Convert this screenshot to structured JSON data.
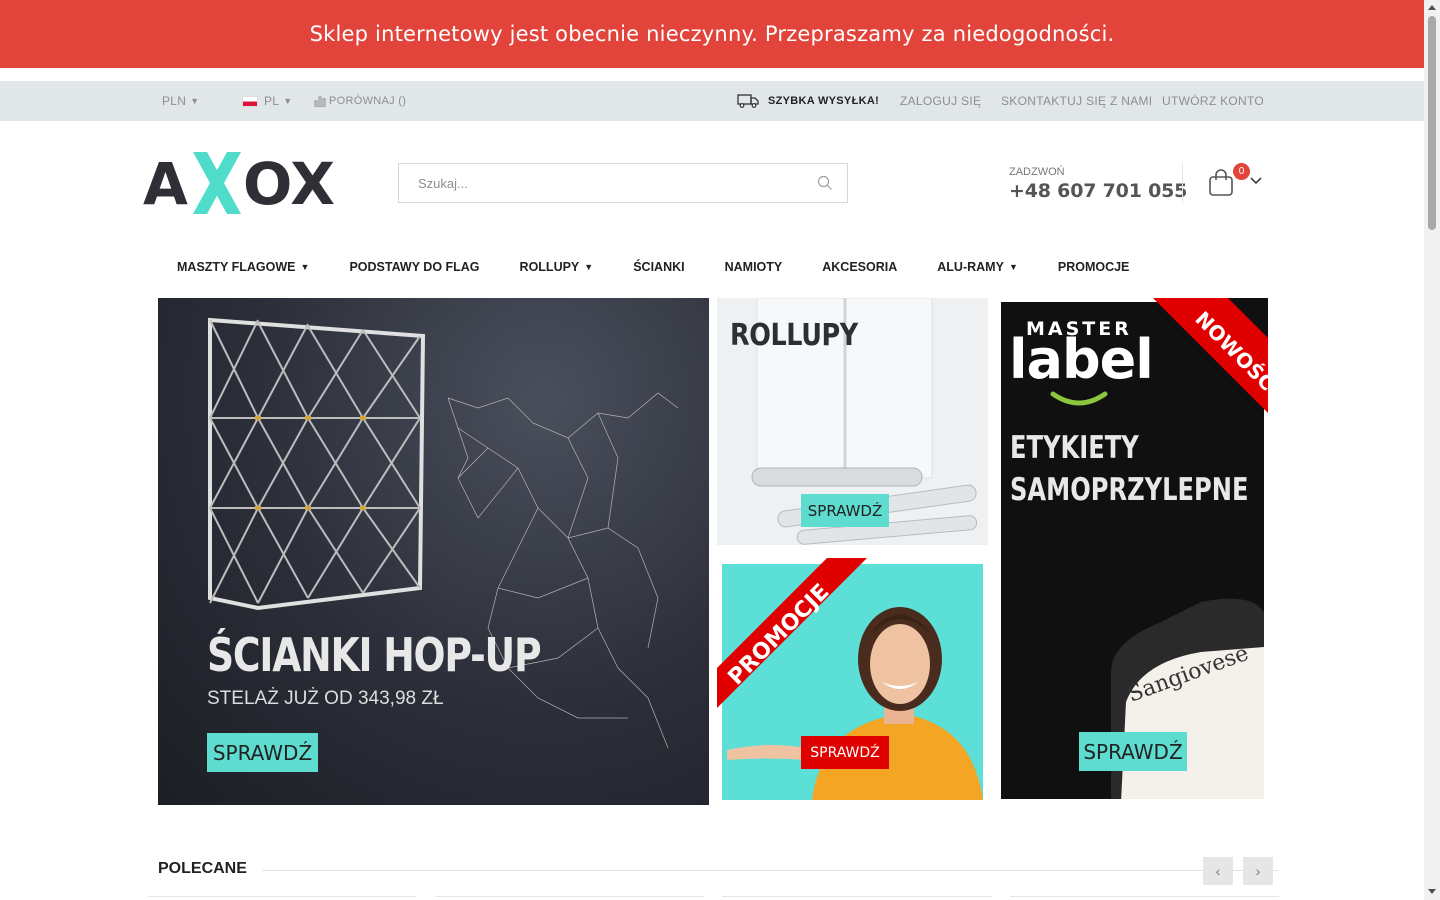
{
  "notice": {
    "text": "Sklep internetowy jest obecnie nieczynny. Przepraszamy za niedogodności."
  },
  "topbar": {
    "currency": "PLN",
    "language": "PL",
    "compare": "PORÓWNAJ ()",
    "shipping": "SZYBKA WYSYŁKA!",
    "login": "ZALOGUJ SIĘ",
    "contact": "SKONTAKTUJ SIĘ Z NAMI",
    "register": "UTWÓRZ KONTO"
  },
  "header": {
    "logo_text": "AXOX",
    "search_placeholder": "Szukaj...",
    "phone_label": "ZADZWOŃ",
    "phone_number": "+48 607 701 055",
    "cart_count": "0"
  },
  "nav": [
    {
      "label": "MASZTY FLAGOWE",
      "has_dropdown": true
    },
    {
      "label": "PODSTAWY DO FLAG",
      "has_dropdown": false
    },
    {
      "label": "ROLLUPY",
      "has_dropdown": true
    },
    {
      "label": "ŚCIANKI",
      "has_dropdown": false
    },
    {
      "label": "NAMIOTY",
      "has_dropdown": false
    },
    {
      "label": "AKCESORIA",
      "has_dropdown": false
    },
    {
      "label": "ALU-RAMY",
      "has_dropdown": true
    },
    {
      "label": "PROMOCJE",
      "has_dropdown": false
    }
  ],
  "banners": {
    "hero": {
      "title": "ŚCIANKI HOP-UP",
      "subtitle": "STELAŻ JUŻ OD 343,98 ZŁ",
      "button": "SPRAWDŹ"
    },
    "rollupy": {
      "title": "ROLLUPY",
      "button": "SPRAWDŹ"
    },
    "promo": {
      "ribbon": "PROMOCJE",
      "button": "SPRAWDŹ"
    },
    "master": {
      "brand_top": "MASTER",
      "brand_main": "label",
      "ribbon": "NOWOŚĆ",
      "title_line1": "ETYKIETY",
      "title_line2": "SAMOPRZYLEPNE",
      "bottle_text": "Sangiovese",
      "button": "SPRAWDŹ"
    }
  },
  "section": {
    "title": "POLECANE",
    "prev": "‹",
    "next": "›"
  },
  "colors": {
    "notice_bg": "#e2433a",
    "accent_teal": "#5ddccf",
    "promo_red": "#e00000"
  }
}
